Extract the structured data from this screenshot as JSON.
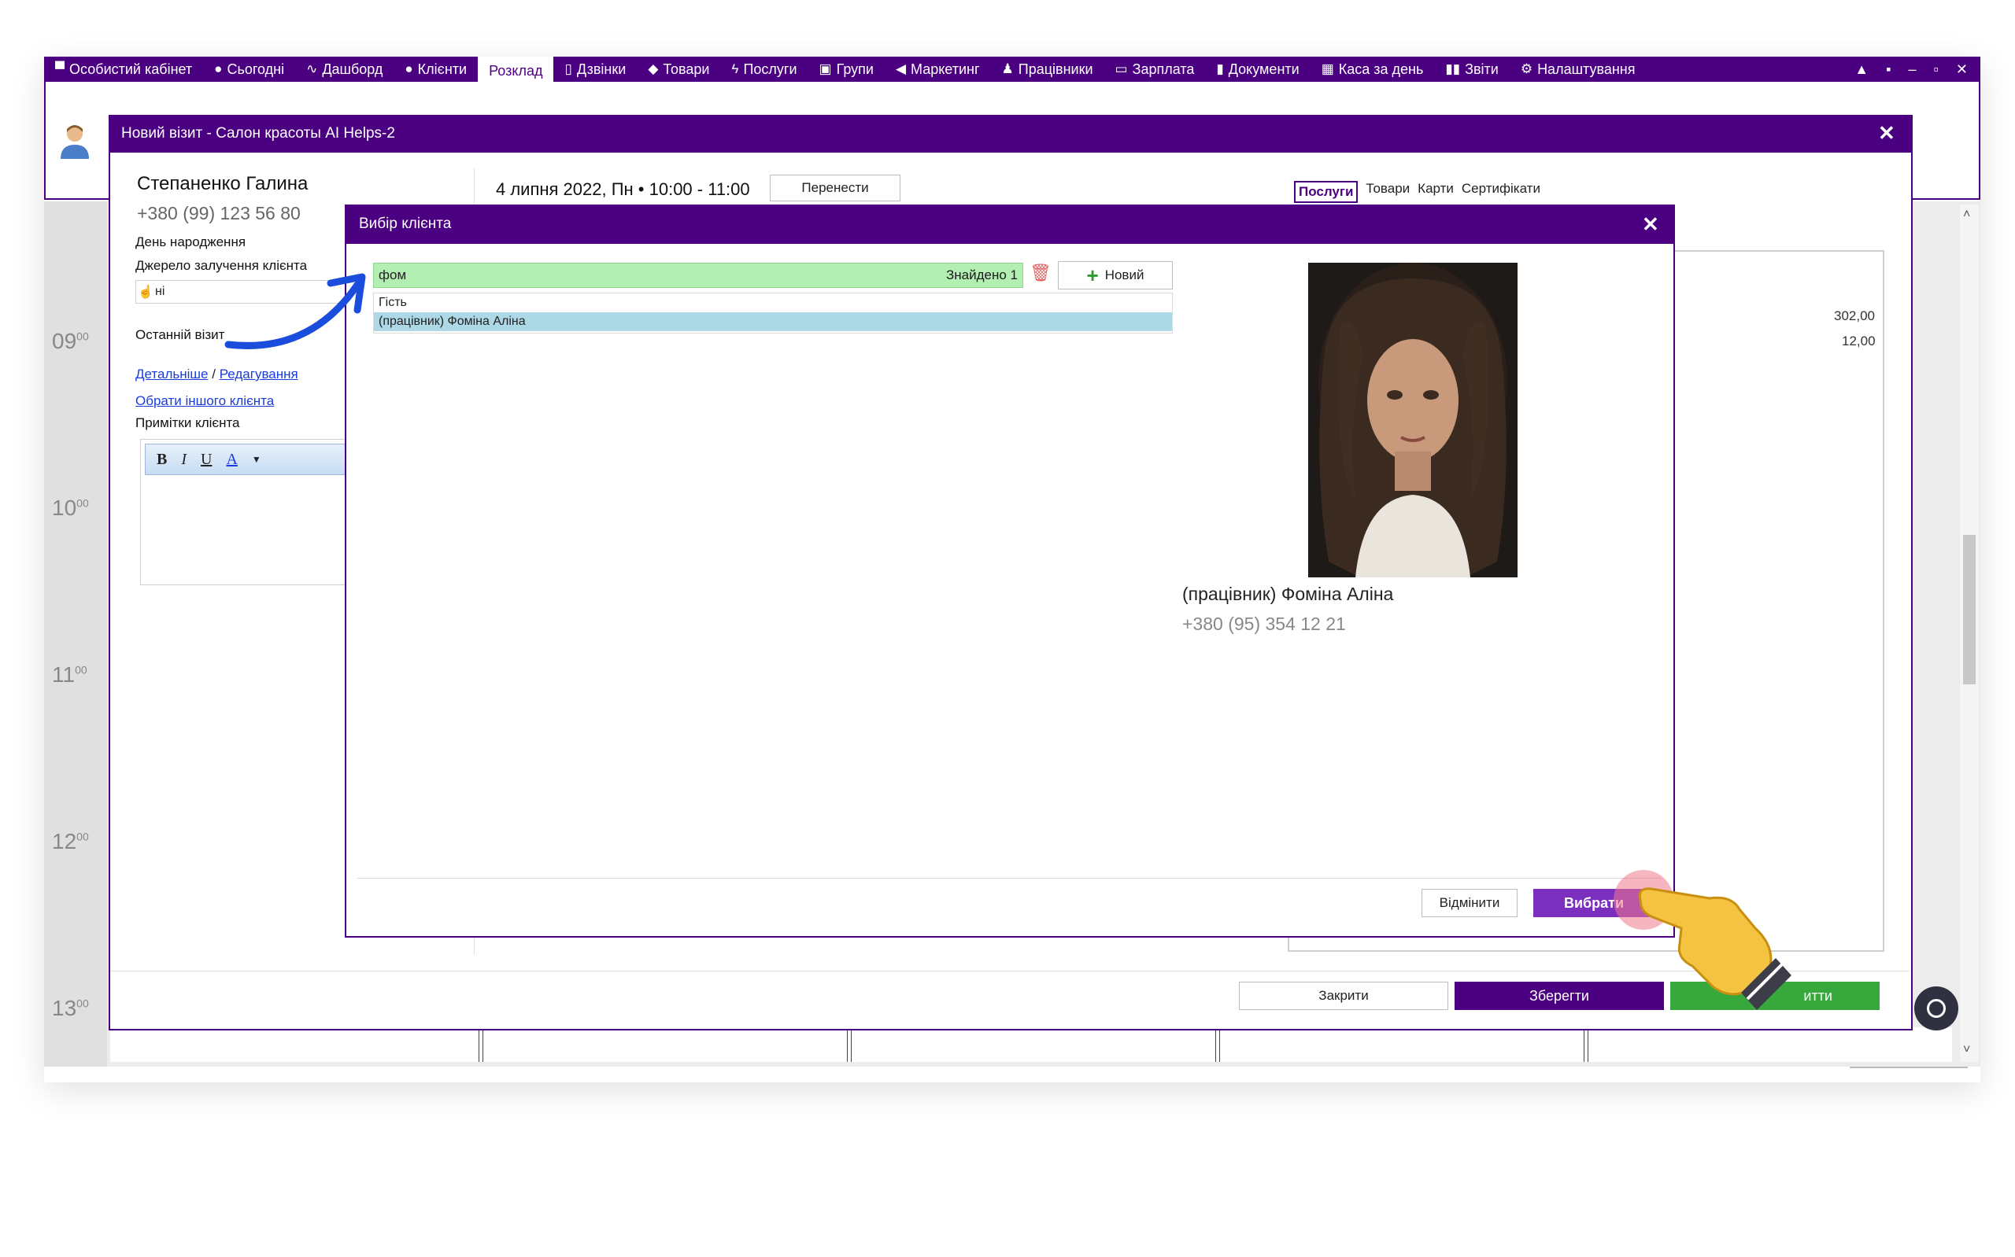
{
  "nav": {
    "items": [
      {
        "label": "Особистий кабінет",
        "icon": "briefcase-icon"
      },
      {
        "label": "Сьогодні",
        "icon": "clock-icon"
      },
      {
        "label": "Дашборд",
        "icon": "pulse-icon"
      },
      {
        "label": "Клієнти",
        "icon": "user-icon"
      },
      {
        "label": "Розклад",
        "icon": "",
        "active": true
      },
      {
        "label": "Дзвінки",
        "icon": "phone-icon"
      },
      {
        "label": "Товари",
        "icon": "box-icon"
      },
      {
        "label": "Послуги",
        "icon": "bolt-icon"
      },
      {
        "label": "Групи",
        "icon": "group-icon"
      },
      {
        "label": "Маркетинг",
        "icon": "megaphone-icon"
      },
      {
        "label": "Працівники",
        "icon": "employee-icon"
      },
      {
        "label": "Зарплата",
        "icon": "money-icon"
      },
      {
        "label": "Документи",
        "icon": "document-icon"
      },
      {
        "label": "Каса за день",
        "icon": "calculator-icon"
      },
      {
        "label": "Звіти",
        "icon": "bar-chart-icon"
      },
      {
        "label": "Налаштування",
        "icon": "gear-icon"
      }
    ]
  },
  "schedule": {
    "times": [
      {
        "hour": "09",
        "min": "00"
      },
      {
        "hour": "10",
        "min": "00"
      },
      {
        "hour": "11",
        "min": "00"
      },
      {
        "hour": "12",
        "min": "00"
      },
      {
        "hour": "13",
        "min": "00"
      }
    ]
  },
  "visit_dialog": {
    "title": "Новий візит - Салон красоты AI Helps-2",
    "client_name": "Степаненко Галина",
    "client_phone": "+380 (99) 123 56 80",
    "birthday_label": "День народження",
    "source_label": "Джерело залучення клієнта",
    "source_value": "ні",
    "last_visit_label": "Останній візит",
    "details_link": "Детальніше",
    "link_separator": "/",
    "edit_link": "Редагування",
    "choose_other_link": "Обрати іншого клієнта",
    "notes_label": "Примітки клієнта",
    "date_text": "4 липня 2022, Пн • 10:00 - 11:00",
    "move_button": "Перенести",
    "tabs": [
      "Послуги",
      "Товари",
      "Карти",
      "Сертифікати"
    ],
    "amounts": [
      "302,00",
      "12,00"
    ],
    "close_button": "Закрити",
    "save_button": "Зберегти",
    "pay_button": "итти"
  },
  "picker": {
    "title": "Вибір клієнта",
    "search_value": "фом",
    "found_text": "Знайдено 1",
    "new_button": "Новий",
    "list": [
      "Гість",
      "(працівник) Фоміна Аліна"
    ],
    "selected_name": "(працівник) Фоміна Аліна",
    "selected_phone": "+380 (95) 354 12 21",
    "cancel_button": "Відмінити",
    "select_button": "Вибрати"
  },
  "colors": {
    "brand": "#4b0082",
    "search_bg": "#b3eeb3",
    "selection": "#add8e6",
    "pay": "#36a83c"
  }
}
